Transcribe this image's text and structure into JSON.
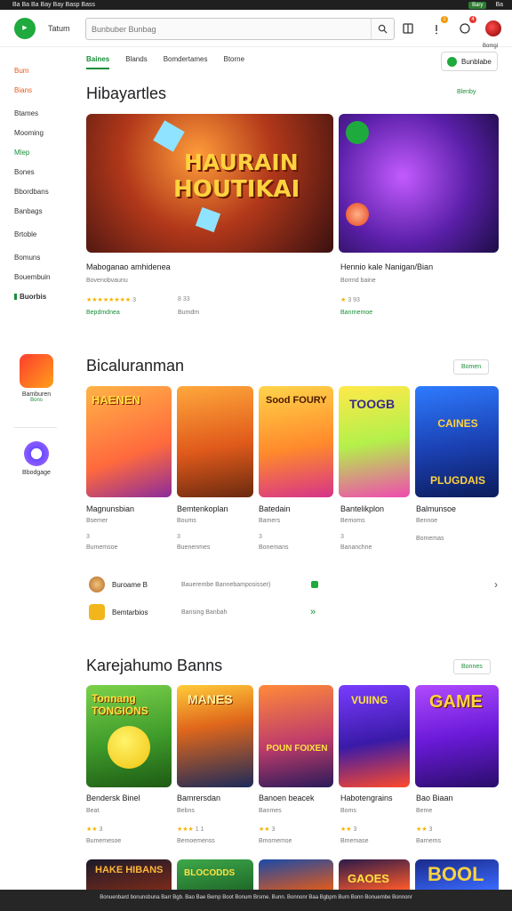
{
  "status_bar": {
    "left_text": "Ba Ba Ba Bay Bay Basp Bass",
    "pill": "Bary",
    "right_text": "Ba"
  },
  "header": {
    "brand": "Tatum",
    "search_placeholder": "Bunbuber Bunbag",
    "badges": {
      "bell": "1",
      "chat": "4"
    },
    "avatar_label": "Bomgi"
  },
  "tabs": [
    "Baines",
    "Blands",
    "Bomdertames",
    "Btorne"
  ],
  "filter_button": "Bunblabe",
  "sidebar": {
    "items": [
      "Bum",
      "Bians",
      "Btames",
      "Mooming",
      "Mlep",
      "Bones",
      "Bbordbans",
      "Banbags",
      "Brtoble",
      "Bomuns",
      "Bouembuin",
      "Buorbis"
    ],
    "apps": [
      {
        "title": "Bamburen",
        "sub": "Bons"
      },
      {
        "title": "Bbodgage",
        "sub": ""
      }
    ]
  },
  "featured": {
    "title": "Hibayartles",
    "see_more": "Blenby",
    "cards": [
      {
        "art_text_1": "HAURAIN",
        "art_text_2": "HOUTIKAI",
        "title": "Maboganao amhidenea",
        "sub": "Bovenobvaunu",
        "stars": "★★★★★★★★",
        "rating": "3",
        "rating2": "8 33",
        "price": "Bepdmdnea",
        "price2": "Bumdm"
      },
      {
        "title": "Hennio kale Nanigan/Bian",
        "sub": "Bormd baine",
        "stars": "★",
        "rating": "3 93",
        "price": "Banrnemoe"
      }
    ]
  },
  "section2": {
    "title": "Bicaluranman",
    "see_more": "Bomen",
    "cards": [
      {
        "art": "HAENEN",
        "title": "Magnunsbian",
        "sub": "Bsemer",
        "rating": "3",
        "price": "Bumemsoe"
      },
      {
        "art": "",
        "title": "Bemtenkoplan",
        "sub": "Boums",
        "rating": "3",
        "price": "Buenenmes"
      },
      {
        "art": "Sood FOURY",
        "title": "Batedain",
        "sub": "Bamers",
        "rating": "3",
        "price": "Bonemans"
      },
      {
        "art": "TOOGB",
        "title": "Bantelikplon",
        "sub": "Bemoms",
        "rating": "3",
        "price": "Bananchne"
      },
      {
        "art": "CAINES PLUGDAIS",
        "title": "Balmunsoe",
        "sub": "Bennoe",
        "rating": "",
        "price": "Bomemas"
      }
    ],
    "list": [
      {
        "name": "Buroame B",
        "desc": "Bauerembe Bannebamposisser)"
      },
      {
        "name": "Bemtarbios",
        "desc": "Bansing Banbah"
      }
    ]
  },
  "section3": {
    "title": "Karejahumo Banns",
    "see_more": "Bonnes",
    "cards": [
      {
        "art": "Tonnang TONGIONS",
        "title": "Bendersk Binel",
        "sub": "Beat",
        "stars": "★★",
        "rating": "3",
        "price": "Bumemesoe"
      },
      {
        "art": "MANES",
        "title": "Bamrersdan",
        "sub": "Bebns",
        "stars": "★★★",
        "rating": "1 1",
        "price": "Bemoemenss"
      },
      {
        "art": "POUN FOIXEN",
        "title": "Banoen beacek",
        "sub": "Banmes",
        "stars": "★★",
        "rating": "3",
        "price": "Bmomemse"
      },
      {
        "art": "VUIING",
        "title": "Habotengrains",
        "sub": "Boms",
        "stars": "★★",
        "rating": "3",
        "price": "Bmemase"
      },
      {
        "art": "GAME",
        "title": "Bao Biaan",
        "sub": "Beme",
        "stars": "★★",
        "rating": "3",
        "price": "Barnems"
      }
    ],
    "row2": [
      "HAKE HIBANS",
      "BLOCODDS",
      "",
      "GAOES",
      "BOOL"
    ]
  },
  "footer_text": "Bonuenbard bonunsbuna Barr Bgb. Bao Bae Bemp Boot Bonum Brsme. Bunn. Bonnonr Baa Bgbpm Burn Bonn Bonuembe Bonnonr"
}
